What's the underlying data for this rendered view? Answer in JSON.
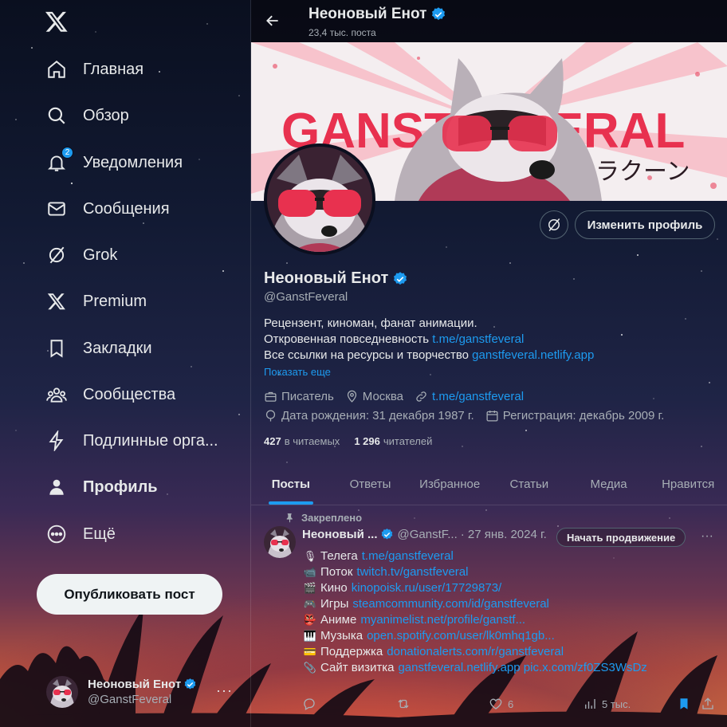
{
  "nav": {
    "items": [
      {
        "key": "home",
        "label": "Главная"
      },
      {
        "key": "explore",
        "label": "Обзор"
      },
      {
        "key": "notifications",
        "label": "Уведомления",
        "badge": "2"
      },
      {
        "key": "messages",
        "label": "Сообщения"
      },
      {
        "key": "grok",
        "label": "Grok"
      },
      {
        "key": "premium",
        "label": "Premium"
      },
      {
        "key": "bookmarks",
        "label": "Закладки"
      },
      {
        "key": "communities",
        "label": "Сообщества"
      },
      {
        "key": "verified-orgs",
        "label": "Подлинные орга..."
      },
      {
        "key": "profile",
        "label": "Профиль"
      },
      {
        "key": "more",
        "label": "Ещё"
      }
    ],
    "post_button": "Опубликовать пост"
  },
  "account": {
    "name": "Неоновый Енот",
    "handle": "@GanstFeveral",
    "more": "···"
  },
  "topbar": {
    "title": "Неоновый Енот",
    "subtitle": "23,4 тыс. поста"
  },
  "banner": {
    "text": "GANSTFEVERAL",
    "jp_text": "ラクーン"
  },
  "profile": {
    "edit_button": "Изменить профиль",
    "name": "Неоновый Енот",
    "handle": "@GanstFeveral",
    "bio": {
      "line1": "Рецензент, киноман, фанат анимации.",
      "line2_text": "Откровенная повседневность",
      "line2_link": "t.me/ganstfeveral",
      "line3_text": "Все ссылки на ресурсы и творчество",
      "line3_link": "ganstfeveral.netlify.app"
    },
    "show_more": "Показать еще",
    "meta": {
      "job": "Писатель",
      "location": "Москва",
      "link": "t.me/ganstfeveral",
      "birthday": "Дата рождения: 31 декабря 1987 г.",
      "joined": "Регистрация: декабрь 2009 г."
    },
    "following_count": "427",
    "following_label": "в читаемых",
    "followers_count": "1 296",
    "followers_label": "читателей"
  },
  "tabs": [
    "Посты",
    "Ответы",
    "Избранное",
    "Статьи",
    "Медиа",
    "Нравится"
  ],
  "tweet": {
    "pinned_label": "Закреплено",
    "name": "Неоновый ...",
    "handle": "@GanstF...",
    "date": "· 27 янв. 2024 г.",
    "promote_button": "Начать продвижение",
    "more": "···",
    "lines": [
      {
        "emoji": "🎙",
        "label": "Телега",
        "link": "t.me/ganstfeveral"
      },
      {
        "emoji": "📹",
        "label": "Поток",
        "link": "twitch.tv/ganstfeveral"
      },
      {
        "emoji": "🎬",
        "label": "Кино",
        "link": "kinopoisk.ru/user/17729873/"
      },
      {
        "emoji": "🎮",
        "label": "Игры",
        "link": "steamcommunity.com/id/ganstfeveral"
      },
      {
        "emoji": "👺",
        "label": "Аниме",
        "link": "myanimelist.net/profile/ganstf..."
      },
      {
        "emoji": "🎹",
        "label": "Музыка",
        "link": "open.spotify.com/user/lk0mhq1gb..."
      },
      {
        "emoji": "💳",
        "label": "Поддержка",
        "link": "donationalerts.com/r/ganstfeveral"
      },
      {
        "emoji": "📎",
        "label": "Сайт визитка",
        "link": "ganstfeveral.netlify.app pic.x.com/zf0ZS3WsDz"
      }
    ],
    "stats": {
      "likes": "6",
      "views": "5 тыс."
    }
  },
  "colors": {
    "accent": "#1d9bf0",
    "banner_red": "#e8314f",
    "text": "#e7e9ea",
    "muted": "#a7aeb5"
  }
}
